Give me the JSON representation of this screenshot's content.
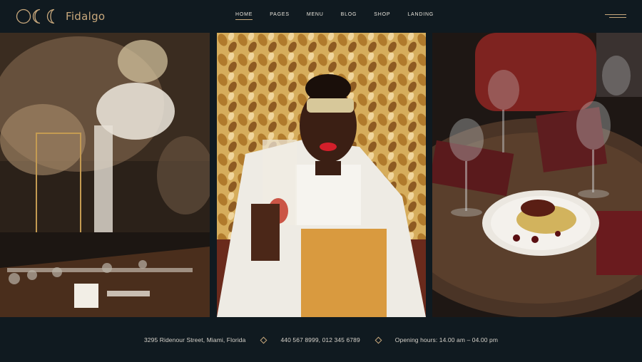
{
  "brand": {
    "name": "Fidalgo",
    "logo_icon": "moon-phases-icon",
    "accent": "#c8a87c"
  },
  "nav": {
    "items": [
      "Home",
      "Pages",
      "Menu",
      "Blog",
      "Shop",
      "Landing"
    ],
    "active": "Home"
  },
  "menu_icon": "hamburger-icon",
  "gallery": {
    "panels": [
      "decorated-banquet-table-photo",
      "woman-toasting-photo",
      "plated-dish-with-wine-glasses-photo"
    ]
  },
  "footer": {
    "address": "3295 Ridenour Street, Miami, Florida",
    "phones": "440 567 8999, 012 345 6789",
    "hours": "Opening hours: 14.00 am – 04.00 pm",
    "separator_icon": "diamond-icon"
  }
}
